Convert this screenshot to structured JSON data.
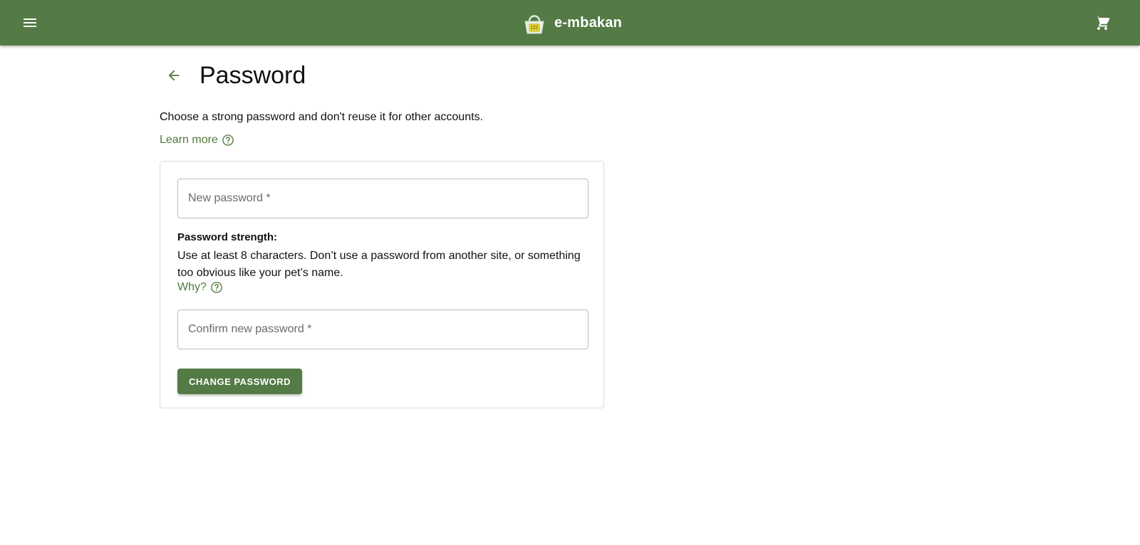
{
  "header": {
    "menu_icon": "menu-icon",
    "brand_name": "e-mbakan",
    "cart_icon": "cart-icon"
  },
  "page": {
    "title": "Password",
    "intro": "Choose a strong password and don't reuse it for other accounts.",
    "learn_more": "Learn more"
  },
  "form": {
    "new_password_placeholder": "New password *",
    "strength_label": "Password strength:",
    "strength_text": "Use at least 8 characters. Don’t use a password from another site, or something too obvious like your pet’s name.",
    "why_link": "Why?",
    "confirm_password_placeholder": "Confirm new password *",
    "submit_label": "CHANGE PASSWORD"
  },
  "colors": {
    "primary": "#547a45",
    "link": "#4f7a3c"
  }
}
